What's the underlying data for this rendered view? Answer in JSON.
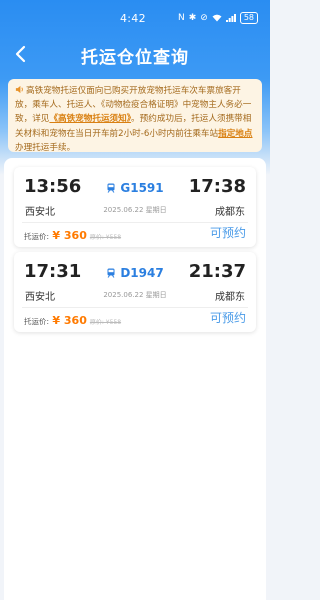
{
  "status_bar": {
    "time": "4:42",
    "icons": [
      "nfc-icon",
      "bluetooth-icon",
      "mute-icon",
      "wifi-icon",
      "signal-icon"
    ],
    "battery": "58"
  },
  "nav": {
    "title": "托运仓位查询"
  },
  "notice": {
    "text_1": "高铁宠物托运仅面向已购买开放宠物托运车次车票旅客开放，乘车人、托运人、《动物检疫合格证明》中宠物主人务必一致，详见",
    "link_rules": "《高铁宠物托运须知》",
    "text_2": "。预约成功后，托运人须携带相关材料和宠物在当日开车前2小时-6小时内前往乘车站",
    "link_location": "指定地点",
    "text_3": "办理托运手续。"
  },
  "trains": [
    {
      "dep_time": "13:56",
      "arr_time": "17:38",
      "train_no": "G1591",
      "dep_station": "西安北",
      "arr_station": "成都东",
      "date": "2025.06.22 星期日",
      "fee_label": "托运价:",
      "price": "¥ 360",
      "orig_price": "原价: ¥558",
      "status": "可预约"
    },
    {
      "dep_time": "17:31",
      "arr_time": "21:37",
      "train_no": "D1947",
      "dep_station": "西安北",
      "arr_station": "成都东",
      "date": "2025.06.22 星期日",
      "fee_label": "托运价:",
      "price": "¥ 360",
      "orig_price": "原价: ¥558",
      "status": "可预约"
    }
  ],
  "colors": {
    "header_blue": "#2a8df2",
    "notice_bg": "#fdf4e4",
    "notice_text": "#a46a1d",
    "price_orange": "#ff7a00",
    "train_blue": "#2b7fe0"
  }
}
